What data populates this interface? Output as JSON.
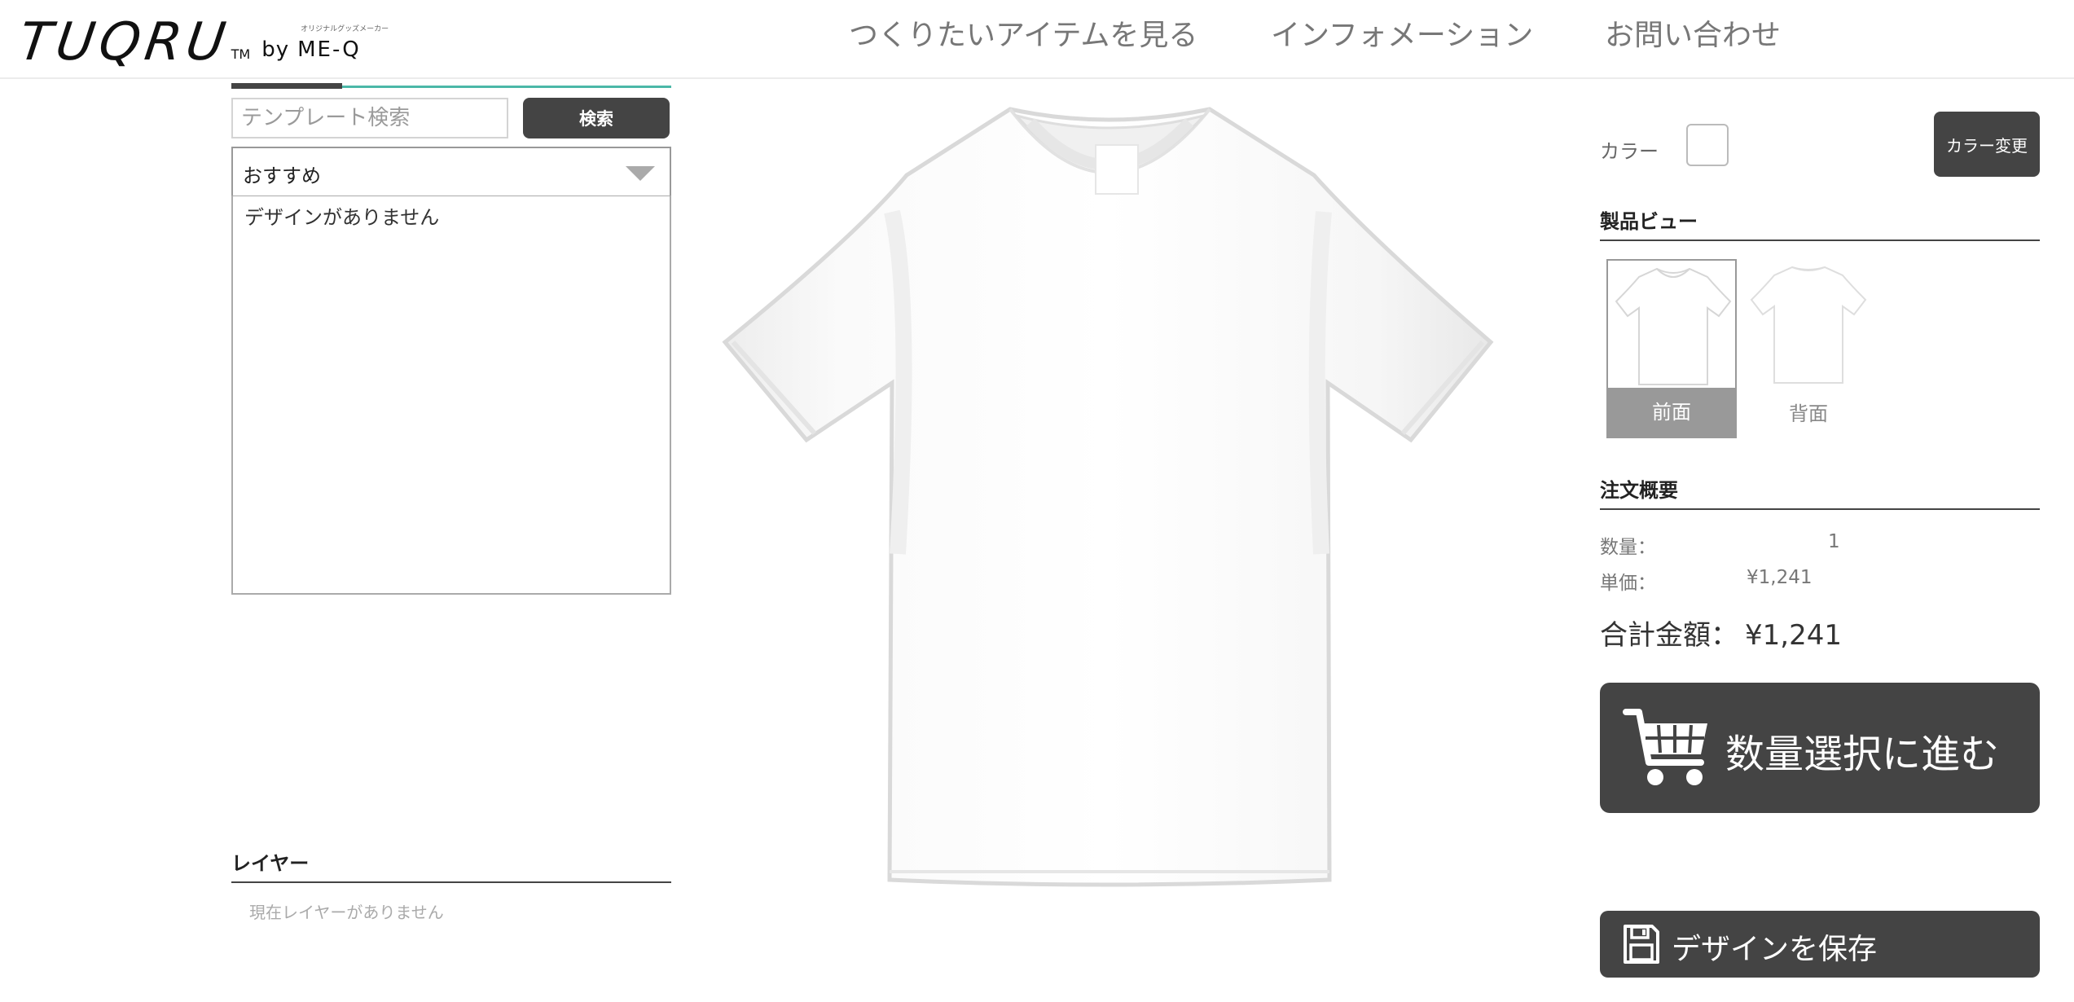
{
  "header": {
    "logo": {
      "main": "TUQRU",
      "tm": "TM",
      "by": "by",
      "brand": "ME-Q",
      "brand_tiny": "オリジナルグッズメーカー"
    },
    "nav": [
      {
        "label": "つくりたいアイテムを見る"
      },
      {
        "label": "インフォメーション"
      },
      {
        "label": "お問い合わせ"
      }
    ]
  },
  "left_panel": {
    "search": {
      "placeholder": "テンプレート検索",
      "value": "",
      "button_label": "検索"
    },
    "sort_select": {
      "selected": "おすすめ"
    },
    "template_list": {
      "empty_message": "デザインがありません"
    },
    "layers": {
      "title": "レイヤー",
      "empty_message": "現在レイヤーがありません"
    }
  },
  "right_panel": {
    "color": {
      "label": "カラー",
      "value": "#ffffff",
      "change_button": "カラー変更"
    },
    "product_view": {
      "title": "製品ビュー",
      "views": [
        {
          "label": "前面",
          "active": true
        },
        {
          "label": "背面",
          "active": false
        }
      ]
    },
    "order_summary": {
      "title": "注文概要",
      "quantity_label": "数量：",
      "quantity_value": "1",
      "unit_price_label": "単価：",
      "unit_price_value": "¥1,241",
      "total_label": "合計金額：",
      "total_value": "¥1,241"
    },
    "proceed_button": {
      "label": "数量選択に進む",
      "icon": "cart-icon"
    },
    "save_button": {
      "label": "デザインを保存",
      "icon": "floppy-disk-icon"
    }
  },
  "colors": {
    "dark_button": "#444444",
    "accent_line": "#4bb8a8",
    "active_view": "#999999"
  }
}
